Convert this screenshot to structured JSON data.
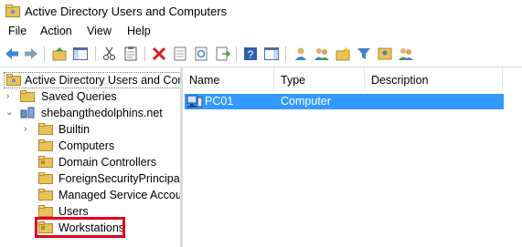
{
  "window": {
    "title": "Active Directory Users and Computers"
  },
  "menu": [
    {
      "label": "File"
    },
    {
      "label": "Action"
    },
    {
      "label": "View"
    },
    {
      "label": "Help"
    }
  ],
  "tree": {
    "root": "Active Directory Users and Com",
    "saved_queries": "Saved Queries",
    "domain": "shebangthedolphins.net",
    "children": [
      {
        "label": "Builtin"
      },
      {
        "label": "Computers"
      },
      {
        "label": "Domain Controllers"
      },
      {
        "label": "ForeignSecurityPrincipals"
      },
      {
        "label": "Managed Service Accounts"
      },
      {
        "label": "Users"
      },
      {
        "label": "Workstations"
      }
    ]
  },
  "list": {
    "columns": [
      {
        "label": "Name"
      },
      {
        "label": "Type"
      },
      {
        "label": "Description"
      }
    ],
    "rows": [
      {
        "name": "PC01",
        "type": "Computer",
        "description": ""
      }
    ]
  },
  "colors": {
    "selection": "#3399ff",
    "highlight_outline": "#e2001a",
    "folder": "#e8c25a"
  }
}
